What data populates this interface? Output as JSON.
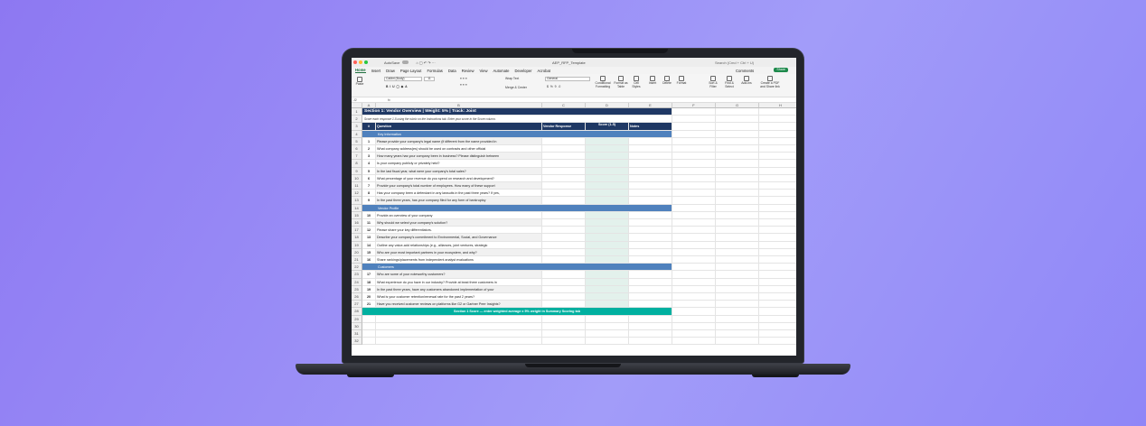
{
  "window": {
    "autosave": "AutoSave",
    "file": "AEP_RFP_Template",
    "search_placeholder": "Search (Cmd + Ctrl + U)"
  },
  "menu": [
    "Home",
    "Insert",
    "Draw",
    "Page Layout",
    "Formulas",
    "Data",
    "Review",
    "View",
    "Automate",
    "Developer",
    "Acrobat"
  ],
  "actions": {
    "comments": "Comments",
    "share": "Share"
  },
  "ribbon": {
    "paste": "Paste",
    "font": "Calibri (Body)",
    "size": "11",
    "wrap": "Wrap Text",
    "merge": "Merge & Center",
    "numfmt": "General",
    "cond": "Conditional Formatting",
    "format_table": "Format as Table",
    "cell_styles": "Cell Styles",
    "insert": "Insert",
    "delete": "Delete",
    "format": "Format",
    "sort": "Sort & Filter",
    "find": "Find & Select",
    "addins": "Add-ins",
    "pdf": "Create a PDF and Share link"
  },
  "formula": {
    "cell": "J2",
    "fx": "fx"
  },
  "columns": [
    "A",
    "B",
    "C",
    "D",
    "E",
    "F",
    "G",
    "H"
  ],
  "rows": [
    {
      "n": "1",
      "type": "sec",
      "b": "Section 1: Vendor Overview  |   Weight: 5%   |   Track: Joint"
    },
    {
      "n": "2",
      "type": "note",
      "b": "Score each response 1-5 using the rubric on the Instructions tab. Enter your score in the Score column."
    },
    {
      "n": "3",
      "type": "hdr",
      "a": "#",
      "b": "Question",
      "c": "Vendor Response",
      "d": "Score (1-5)",
      "e": "Notes"
    },
    {
      "n": "4",
      "type": "sub",
      "b": "Key Information"
    },
    {
      "n": "5",
      "a": "1",
      "b": "Please provide your company's legal name (if different from the name provided in"
    },
    {
      "n": "6",
      "a": "2",
      "b": "What company address(es) should be used on contracts and other official"
    },
    {
      "n": "7",
      "a": "3",
      "b": "How many years has your company been in business? Please distinguish between"
    },
    {
      "n": "8",
      "a": "4",
      "b": "Is your company publicly or privately held?"
    },
    {
      "n": "9",
      "a": "5",
      "b": "In the last fiscal year, what were your company's total sales?"
    },
    {
      "n": "10",
      "a": "6",
      "b": "What percentage of your revenue do you spend on research and development?"
    },
    {
      "n": "11",
      "a": "7",
      "b": "Provide your company's total number of employees. How many of these support"
    },
    {
      "n": "12",
      "a": "8",
      "b": "Has your company been a defendant in any lawsuits in the past three years? If yes,"
    },
    {
      "n": "13",
      "a": "9",
      "b": "In the past three years, has your company filed for any form of bankruptcy"
    },
    {
      "n": "14",
      "type": "sub",
      "b": "Vendor Profile"
    },
    {
      "n": "15",
      "a": "10",
      "b": "Provide an overview of your company"
    },
    {
      "n": "16",
      "a": "11",
      "b": "Why should we select your company's solution?"
    },
    {
      "n": "17",
      "a": "12",
      "b": "Please share your key differentiators."
    },
    {
      "n": "18",
      "a": "13",
      "b": "Describe your company's commitment to Environmental, Social, and Governance"
    },
    {
      "n": "19",
      "a": "14",
      "b": "Outline any value-add relationships (e.g., alliances, joint ventures, strategic"
    },
    {
      "n": "20",
      "a": "15",
      "b": "Who are your most important partners in your ecosystem, and why?"
    },
    {
      "n": "21",
      "a": "16",
      "b": "Share rankings/placements from independent analyst evaluations"
    },
    {
      "n": "22",
      "type": "sub",
      "b": "Customers"
    },
    {
      "n": "23",
      "a": "17",
      "b": "Who are some of your noteworthy customers?"
    },
    {
      "n": "24",
      "a": "18",
      "b": "What experience do you have in our industry? Provide at least three customers in"
    },
    {
      "n": "25",
      "a": "19",
      "b": "In the past three years, have any customers abandoned implementation of your"
    },
    {
      "n": "26",
      "a": "20",
      "b": "What is your customer retention/renewal rate for the past 2 years?"
    },
    {
      "n": "27",
      "a": "21",
      "b": "Have you received customer reviews on platforms like G2 or Gartner Peer Insights?"
    },
    {
      "n": "28",
      "type": "score",
      "b": "Section 1 Score — enter weighted average x 5% weight in Summary Scoring tab"
    },
    {
      "n": "29"
    },
    {
      "n": "30"
    },
    {
      "n": "31"
    },
    {
      "n": "32"
    }
  ]
}
